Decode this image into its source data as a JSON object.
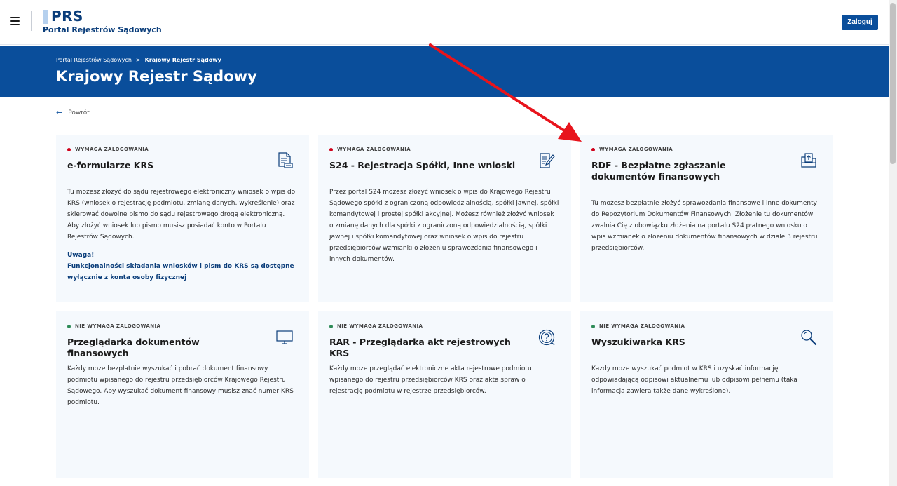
{
  "header": {
    "logo_title": "PRS",
    "logo_subtitle": "Portal Rejestrów Sądowych",
    "login_label": "Zaloguj"
  },
  "banner": {
    "breadcrumb": [
      "Portal Rejestrów Sądowych",
      "Krajowy Rejestr Sądowy"
    ],
    "breadcrumb_sep": ">",
    "title": "Krajowy Rejestr Sądowy"
  },
  "back": {
    "arrow": "←",
    "label": "Powrót"
  },
  "cards": [
    {
      "badge": "WYMAGA ZALOGOWANIA",
      "title": "e-formularze KRS",
      "desc": "Tu możesz złożyć do sądu rejestrowego elektroniczny wniosek o wpis do KRS (wniosek o rejestrację podmiotu, zmianę danych, wykreślenie) oraz skierować dowolne pismo do sądu rejestrowego drogą elektroniczną. Aby złożyć wniosek lub pismo musisz posiadać konto w Portalu Rejestrów Sądowych.",
      "note_title": "Uwaga!",
      "note_text": "Funkcjonalności składania wniosków i pism do KRS są dostępne wyłącznie z konta osoby fizycznej"
    },
    {
      "badge": "WYMAGA ZALOGOWANIA",
      "title": "S24 - Rejestracja Spółki, Inne wnioski",
      "desc": "Przez portal S24 możesz złożyć wniosek o wpis do Krajowego Rejestru Sądowego spółki z ograniczoną odpowiedzialnością, spółki jawnej, spółki komandytowej i prostej spółki akcyjnej. Możesz również złożyć wniosek o zmianę danych dla spółki z ograniczoną odpowiedzialnością, spółki jawnej i spółki komandytowej oraz wniosek o wpis do rejestru przedsiębiorców wzmianki o złożeniu sprawozdania finansowego i innych dokumentów."
    },
    {
      "badge": "WYMAGA ZALOGOWANIA",
      "title": "RDF - Bezpłatne zgłaszanie dokumentów finansowych",
      "desc": "Tu możesz bezpłatnie złożyć sprawozdania finansowe i inne dokumenty do Repozytorium Dokumentów Finansowych. Złożenie tu dokumentów zwalnia Cię z obowiązku złożenia na portalu S24 płatnego wniosku o wpis wzmianek o złożeniu dokumentów finansowych w dziale 3 rejestru przedsiębiorców."
    },
    {
      "badge": "NIE WYMAGA ZALOGOWANIA",
      "title": "Przeglądarka dokumentów finansowych",
      "desc": "Każdy może bezpłatnie wyszukać i pobrać dokument finansowy podmiotu wpisanego do rejestru przedsiębiorców Krajowego Rejestru Sądowego. Aby wyszukać dokument finansowy musisz znać numer KRS podmiotu."
    },
    {
      "badge": "NIE WYMAGA ZALOGOWANIA",
      "title": "RAR - Przeglądarka akt rejestrowych KRS",
      "desc": "Każdy może przeglądać elektroniczne akta rejestrowe podmiotu wpisanego do rejestru przedsiębiorców KRS oraz akta spraw o rejestrację podmiotu w rejestrze przedsiębiorców."
    },
    {
      "badge": "NIE WYMAGA ZALOGOWANIA",
      "title": "Wyszukiwarka KRS",
      "desc": "Każdy może wyszukać podmiot w KRS i uzyskać informację odpowiadającą odpisowi aktualnemu lub odpisowi pełnemu (taka informacja zawiera także dane wykreślone)."
    }
  ],
  "icons": {
    "menu": "hamburger-menu-icon",
    "card0": "document-form-icon",
    "card1": "document-pen-icon",
    "card2": "financial-document-upload-icon",
    "card3": "monitor-icon",
    "card4": "question-circle-icon",
    "card5": "magnifier-icon"
  },
  "colors": {
    "brand_blue": "#0a4e9b",
    "card_bg": "#f5f9fd",
    "login_required_dot": "#d0021b",
    "no_login_dot": "#2e8b57",
    "annotation_arrow": "#e8141c"
  }
}
